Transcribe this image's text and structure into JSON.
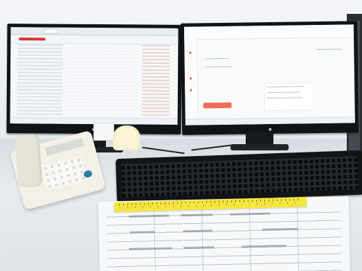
{
  "colors": {
    "monitor_bezel": "#111417",
    "keyboard": "#121416",
    "ruler": "#f4e63c",
    "screen_accent": "#f06c54",
    "phone_button": "#2e7ba5"
  }
}
